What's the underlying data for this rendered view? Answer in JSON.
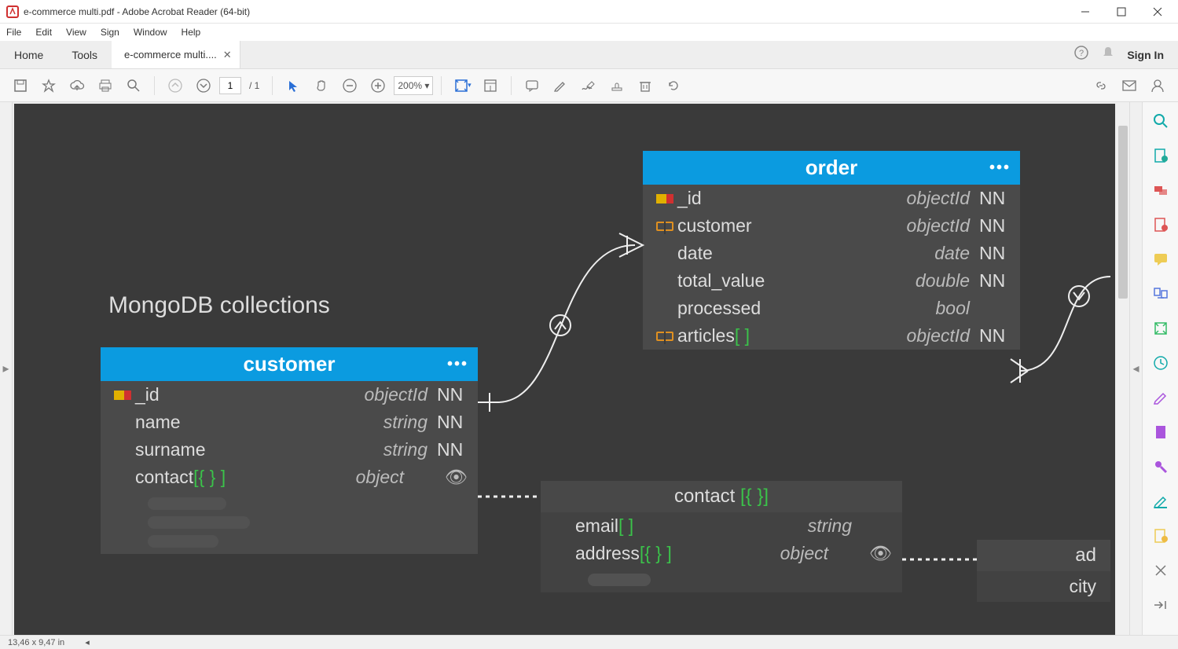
{
  "window": {
    "title": "e-commerce multi.pdf - Adobe Acrobat Reader (64-bit)"
  },
  "menu": {
    "file": "File",
    "edit": "Edit",
    "view": "View",
    "sign": "Sign",
    "window": "Window",
    "help": "Help"
  },
  "tabs": {
    "home": "Home",
    "tools": "Tools",
    "doc": "e-commerce multi....",
    "signin": "Sign In"
  },
  "toolbar": {
    "page_current": "1",
    "page_total": "/ 1",
    "zoom": "200%"
  },
  "status": {
    "coords": "13,46 x 9,47 in"
  },
  "doc": {
    "heading": "MongoDB collections",
    "customer": {
      "title": "customer",
      "fields": [
        {
          "name": "_id",
          "suffix": "",
          "type": "objectId",
          "nn": "NN",
          "icon": "key"
        },
        {
          "name": "name",
          "suffix": "",
          "type": "string",
          "nn": "NN",
          "icon": ""
        },
        {
          "name": "surname",
          "suffix": "",
          "type": "string",
          "nn": "NN",
          "icon": ""
        },
        {
          "name": "contact",
          "suffix": "[{ } ]",
          "type": "object",
          "nn": "",
          "icon": "",
          "eye": true
        }
      ]
    },
    "order": {
      "title": "order",
      "fields": [
        {
          "name": "_id",
          "suffix": "",
          "type": "objectId",
          "nn": "NN",
          "icon": "key"
        },
        {
          "name": "customer",
          "suffix": "",
          "type": "objectId",
          "nn": "NN",
          "icon": "link"
        },
        {
          "name": "date",
          "suffix": "",
          "type": "date",
          "nn": "NN",
          "icon": ""
        },
        {
          "name": "total_value",
          "suffix": "",
          "type": "double",
          "nn": "NN",
          "icon": ""
        },
        {
          "name": "processed",
          "suffix": "",
          "type": "bool",
          "nn": "",
          "icon": ""
        },
        {
          "name": "articles",
          "suffix": "[  ]",
          "type": "objectId",
          "nn": "NN",
          "icon": "link"
        }
      ]
    },
    "contact": {
      "title": "contact ",
      "title_suffix": "[{ }]",
      "fields": [
        {
          "name": "email",
          "suffix": "[  ]",
          "type": "string",
          "nn": "",
          "eye": false
        },
        {
          "name": "address",
          "suffix": "[{ } ]",
          "type": "object",
          "nn": "",
          "eye": true
        }
      ]
    },
    "partial": {
      "title": "ad",
      "row1": "city"
    }
  },
  "side_icons": [
    "search",
    "export",
    "combine",
    "organize",
    "comment",
    "rotate",
    "compress",
    "fill-sign",
    "edit",
    "protect",
    "stamp",
    "redact",
    "export2",
    "more",
    "collapse"
  ]
}
